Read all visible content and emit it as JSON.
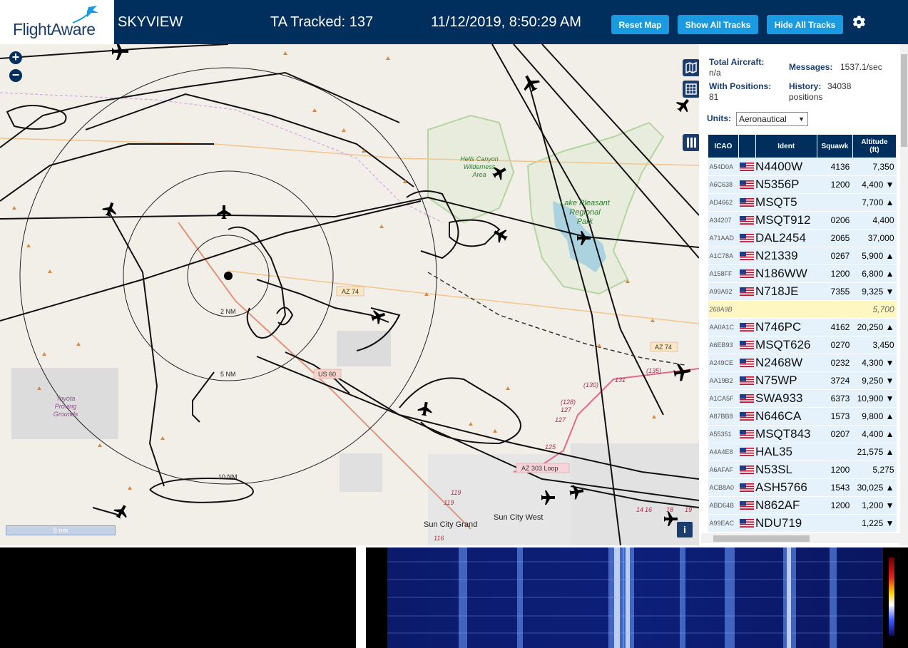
{
  "header": {
    "logo_text": "FlightAware",
    "app_name": "SKYVIEW",
    "ta_tracked": "TA Tracked: 137",
    "datetime": "11/12/2019, 8:50:29 AM",
    "buttons": {
      "reset_map": "Reset Map",
      "show_all_tracks": "Show All Tracks",
      "hide_all_tracks": "Hide All Tracks"
    }
  },
  "map": {
    "zoom_in": "+",
    "zoom_out": "−",
    "range_labels": [
      "2 NM",
      "5 NM",
      "10 NM"
    ],
    "place_labels": {
      "hells_canyon": [
        "Hells Canyon",
        "Wilderness",
        "Area"
      ],
      "lake_pleasant": [
        "Lake Pleasant",
        "Regional",
        "Park"
      ],
      "toyota": [
        "Toyota",
        "Proving",
        "Grounds"
      ],
      "sun_city_grand": "Sun City Grand",
      "sun_city_west": "Sun City West"
    },
    "road_labels": [
      "AZ 74",
      "AZ 74",
      "US 60",
      "AZ 303 Loop"
    ],
    "route_numbers": [
      "(130)",
      "(135)",
      "131",
      "(128)",
      "127",
      "127",
      "125",
      "119",
      "119",
      "116",
      "14",
      "16",
      "18",
      "19"
    ],
    "scale_label": "5 nm",
    "info": "i"
  },
  "stats": {
    "total_aircraft_label": "Total Aircraft:",
    "total_aircraft_value": "n/a",
    "with_positions_label": "With Positions:",
    "with_positions_value": "81",
    "messages_label": "Messages:",
    "messages_value": "1537.1/sec",
    "history_label": "History:",
    "history_value_1": "34038",
    "history_value_2": "positions",
    "units_label": "Units:",
    "units_value": "Aeronautical"
  },
  "table": {
    "headers": {
      "icao": "ICAO",
      "ident": "Ident",
      "squawk": "Squawk",
      "altitude": "Altitude",
      "altitude_unit": "(ft)"
    },
    "rows": [
      {
        "icao": "A54D0A",
        "ident": "N4400W",
        "squawk": "4136",
        "altitude": "7,350"
      },
      {
        "icao": "A6C638",
        "ident": "N5356P",
        "squawk": "1200",
        "altitude": "4,400 ▼"
      },
      {
        "icao": "AD4662",
        "ident": "MSQT5",
        "squawk": "",
        "altitude": "7,700 ▲"
      },
      {
        "icao": "A34207",
        "ident": "MSQT912",
        "squawk": "0206",
        "altitude": "4,400"
      },
      {
        "icao": "A71AAD",
        "ident": "DAL2454",
        "squawk": "2065",
        "altitude": "37,000"
      },
      {
        "icao": "A1C78A",
        "ident": "N21339",
        "squawk": "0267",
        "altitude": "5,900 ▲"
      },
      {
        "icao": "A158FF",
        "ident": "N186WW",
        "squawk": "1200",
        "altitude": "6,800 ▲"
      },
      {
        "icao": "A99A92",
        "ident": "N718JE",
        "squawk": "7355",
        "altitude": "9,325 ▼"
      },
      {
        "icao": "268A9B",
        "ident": "",
        "squawk": "",
        "altitude": "5,700",
        "highlight": true
      },
      {
        "icao": "AA0A1C",
        "ident": "N746PC",
        "squawk": "4162",
        "altitude": "20,250 ▲"
      },
      {
        "icao": "A6EB93",
        "ident": "MSQT626",
        "squawk": "0270",
        "altitude": "3,450"
      },
      {
        "icao": "A249CE",
        "ident": "N2468W",
        "squawk": "0232",
        "altitude": "4,300 ▼"
      },
      {
        "icao": "AA19B2",
        "ident": "N75WP",
        "squawk": "3724",
        "altitude": "9,250 ▼"
      },
      {
        "icao": "A1CA5F",
        "ident": "SWA933",
        "squawk": "6373",
        "altitude": "10,900 ▼"
      },
      {
        "icao": "A87BB8",
        "ident": "N646CA",
        "squawk": "1573",
        "altitude": "9,800 ▲"
      },
      {
        "icao": "A55351",
        "ident": "MSQT843",
        "squawk": "0207",
        "altitude": "4,400 ▲"
      },
      {
        "icao": "A4A4E8",
        "ident": "HAL35",
        "squawk": "",
        "altitude": "21,575 ▲"
      },
      {
        "icao": "A6AFAF",
        "ident": "N53SL",
        "squawk": "1200",
        "altitude": "5,275"
      },
      {
        "icao": "ACB8A0",
        "ident": "ASH5766",
        "squawk": "1543",
        "altitude": "30,025 ▲"
      },
      {
        "icao": "ABD64B",
        "ident": "N862AF",
        "squawk": "1200",
        "altitude": "1,200 ▼"
      },
      {
        "icao": "A99EAC",
        "ident": "NDU719",
        "squawk": "",
        "altitude": "1,225 ▼"
      }
    ]
  },
  "colors": {
    "header_bg": "#002f5d",
    "button_blue": "#1a9ae0",
    "row_bg": "#e5f2fb",
    "highlight_row": "#fff7c2"
  }
}
